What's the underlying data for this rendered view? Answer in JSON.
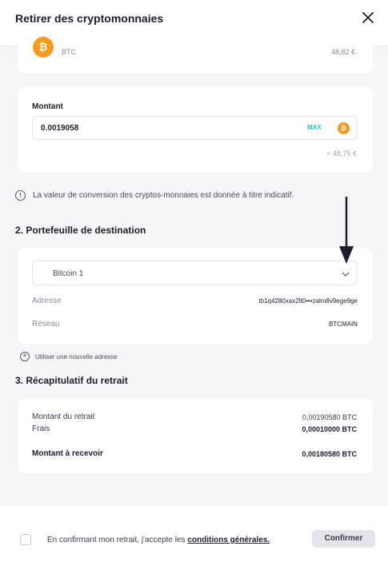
{
  "header": {
    "title": "Retirer des cryptomonnaies",
    "close_icon": "close-icon"
  },
  "asset": {
    "coin_glyph": "₿",
    "symbol": "BTC",
    "fiat_value": "48,82 €",
    "icon": "bitcoin-icon",
    "color": "#f39a1f"
  },
  "amount": {
    "label": "Montant",
    "value": "0.0019058",
    "max_label": "MAX",
    "coin_glyph": "₿",
    "approx": "≈ 48,75 €",
    "accent_color": "#2ac3c8"
  },
  "info": {
    "icon": "info-icon",
    "glyph": "!",
    "text": "La valeur de conversion des cryptos-monnaies est donnée à titre indicatif."
  },
  "destination": {
    "title": "2. Portefeuille de destination",
    "wallet": "Bitcoin 1",
    "address_label": "Adresse",
    "address_value": "tb1q4280xax2lt0•••zalm8v9ege9ge",
    "network_label": "Réseau",
    "network_value": "BTCMAIN",
    "new_address": "Utiliser une nouvelle adresse",
    "plus_glyph": "+"
  },
  "summary": {
    "title": "3. Récapitulatif du retrait",
    "rows": [
      {
        "label": "Montant du retrait",
        "value": "0,00190580  BTC"
      },
      {
        "label": "Frais",
        "value": "0,00010000  BTC"
      },
      {
        "label": "Montant à recevoir",
        "value": "0,00180580  BTC"
      }
    ]
  },
  "footer": {
    "consent_prefix": "En confirmant mon retrait, j'accepte les ",
    "terms_link": "conditions générales.",
    "confirm_label": "Confirmer"
  }
}
